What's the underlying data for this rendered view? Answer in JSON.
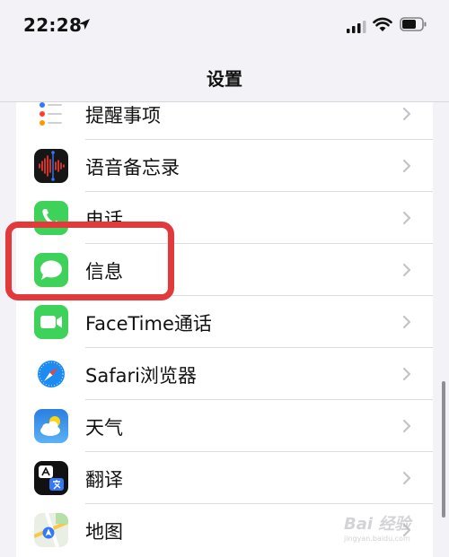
{
  "status_bar": {
    "time": "22:28",
    "icons": [
      "location-arrow-icon",
      "cellular-signal-icon",
      "wifi-icon",
      "battery-icon"
    ]
  },
  "nav": {
    "title": "设置"
  },
  "list": {
    "items": [
      {
        "label": "提醒事项",
        "icon": "reminders-icon"
      },
      {
        "label": "语音备忘录",
        "icon": "voice-memos-icon"
      },
      {
        "label": "电话",
        "icon": "phone-icon"
      },
      {
        "label": "信息",
        "icon": "messages-icon"
      },
      {
        "label": "FaceTime通话",
        "icon": "facetime-icon"
      },
      {
        "label": "Safari浏览器",
        "icon": "safari-icon"
      },
      {
        "label": "天气",
        "icon": "weather-icon"
      },
      {
        "label": "翻译",
        "icon": "translate-icon"
      },
      {
        "label": "地图",
        "icon": "maps-icon"
      }
    ]
  },
  "annotation": {
    "highlight_color": "#e23a3a",
    "highlighted_item": "信息"
  },
  "watermark": {
    "main": "Bai 经验",
    "sub": "jingyan.baidu.com"
  },
  "colors": {
    "background": "#f2f2f7",
    "row_background": "#ffffff",
    "messages_green": "#3fd25a",
    "safari_blue": "#1d8cf2"
  }
}
